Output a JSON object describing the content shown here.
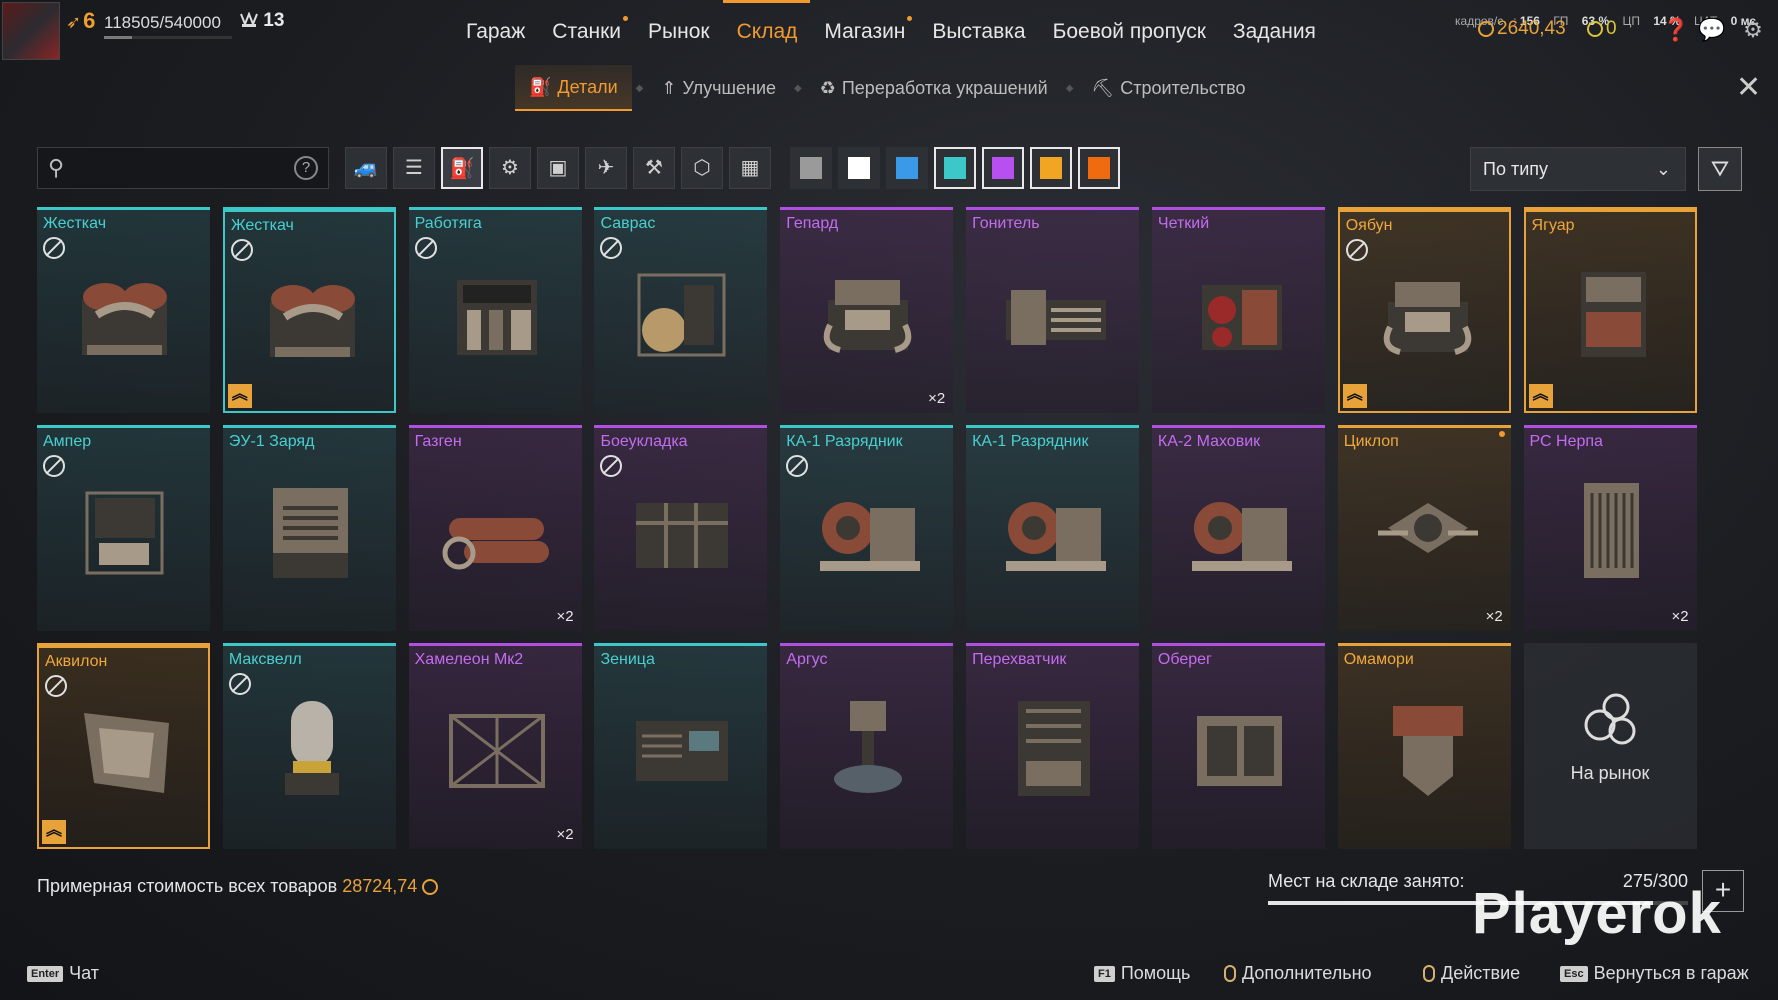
{
  "player": {
    "level": "6",
    "xp": "118505/540000",
    "xp_fraction": 0.22,
    "rank": "13"
  },
  "main_nav": [
    {
      "label": "Гараж"
    },
    {
      "label": "Станки",
      "dot": true
    },
    {
      "label": "Рынок"
    },
    {
      "label": "Склад",
      "active": true
    },
    {
      "label": "Магазин",
      "dot": true
    },
    {
      "label": "Выставка"
    },
    {
      "label": "Боевой пропуск"
    },
    {
      "label": "Задания"
    }
  ],
  "stats": {
    "fps_label": "кадров/с",
    "fps": "156",
    "gpu_label": "ГП",
    "gpu": "63 %",
    "cpu_label": "ЦП",
    "cpu": "14 %",
    "ping_label": "ЦАТ",
    "ping": "0 мс"
  },
  "currency": {
    "coins": "2640,43",
    "badges": "0"
  },
  "sub_nav": [
    {
      "label": "Детали",
      "active": true,
      "icon": "engine-icon"
    },
    {
      "label": "Улучшение",
      "icon": "upgrade-icon"
    },
    {
      "label": "Переработка украшений",
      "icon": "recycle-icon"
    },
    {
      "label": "Строительство",
      "icon": "build-icon"
    }
  ],
  "search": {
    "placeholder": ""
  },
  "category_filters": [
    {
      "icon": "cabin-icon"
    },
    {
      "icon": "weapon-icon"
    },
    {
      "icon": "engine-icon",
      "selected": true
    },
    {
      "icon": "wheel-icon"
    },
    {
      "icon": "frame-icon"
    },
    {
      "icon": "drone-icon"
    },
    {
      "icon": "tool-icon"
    },
    {
      "icon": "gear-hex-icon"
    },
    {
      "icon": "all-grid-icon"
    }
  ],
  "rarity_filters": [
    {
      "color": "#9a9a9a"
    },
    {
      "color": "#ffffff"
    },
    {
      "color": "#3b9ae8"
    },
    {
      "color": "#3cc8c8",
      "selected": true
    },
    {
      "color": "#b84ff0",
      "selected": true
    },
    {
      "color": "#f2a423",
      "selected": true
    },
    {
      "color": "#f06a10",
      "selected": true
    }
  ],
  "sort": {
    "label": "По типу"
  },
  "items": [
    {
      "name": "Жесткач",
      "rarity": "cyan",
      "nosell": true,
      "art": "engine-twin"
    },
    {
      "name": "Жесткач",
      "rarity": "cyan",
      "nosell": true,
      "art": "engine-twin",
      "selected": true,
      "upgrade": true
    },
    {
      "name": "Работяга",
      "rarity": "cyan",
      "nosell": true,
      "art": "engine-block"
    },
    {
      "name": "Саврас",
      "rarity": "cyan",
      "nosell": true,
      "art": "engine-cage"
    },
    {
      "name": "Гепард",
      "rarity": "purple",
      "art": "engine-v8",
      "count": "×2"
    },
    {
      "name": "Гонитель",
      "rarity": "purple",
      "art": "engine-long"
    },
    {
      "name": "Четкий",
      "rarity": "purple",
      "art": "engine-red"
    },
    {
      "name": "Оябун",
      "rarity": "orange",
      "nosell": true,
      "art": "engine-v8",
      "selected": true,
      "upgrade": true
    },
    {
      "name": "Ягуар",
      "rarity": "orange",
      "art": "engine-tall",
      "selected": true,
      "upgrade": true
    },
    {
      "name": "Ампер",
      "rarity": "cyan",
      "nosell": true,
      "art": "generator"
    },
    {
      "name": "ЭУ-1 Заряд",
      "rarity": "cyan",
      "art": "box-vent"
    },
    {
      "name": "Газген",
      "rarity": "purple",
      "art": "tanks",
      "count": "×2"
    },
    {
      "name": "Боеукладка",
      "rarity": "purple",
      "nosell": true,
      "art": "crate"
    },
    {
      "name": "КА-1 Разрядник",
      "rarity": "cyan",
      "nosell": true,
      "art": "coils"
    },
    {
      "name": "КА-1 Разрядник",
      "rarity": "cyan",
      "art": "coils"
    },
    {
      "name": "КА-2 Маховик",
      "rarity": "purple",
      "art": "coils"
    },
    {
      "name": "Циклоп",
      "rarity": "orange",
      "art": "drone",
      "count": "×2",
      "newdot": true
    },
    {
      "name": "РС Нерпа",
      "rarity": "purple",
      "art": "radiator",
      "count": "×2"
    },
    {
      "name": "Аквилон",
      "rarity": "orange",
      "nosell": true,
      "art": "wedge",
      "selected": true,
      "upgrade": true
    },
    {
      "name": "Максвелл",
      "rarity": "cyan",
      "nosell": true,
      "art": "capsule"
    },
    {
      "name": "Хамелеон Мк2",
      "rarity": "purple",
      "art": "cage-crate",
      "count": "×2"
    },
    {
      "name": "Зеница",
      "rarity": "cyan",
      "art": "console"
    },
    {
      "name": "Аргус",
      "rarity": "purple",
      "art": "turret"
    },
    {
      "name": "Перехватчик",
      "rarity": "purple",
      "art": "tower"
    },
    {
      "name": "Оберег",
      "rarity": "purple",
      "art": "block"
    },
    {
      "name": "Омамори",
      "rarity": "orange",
      "art": "shield"
    }
  ],
  "market_tile": {
    "label": "На рынок"
  },
  "footer": {
    "total_label": "Примерная стоимость всех товаров",
    "total_value": "28724,74",
    "storage_label": "Мест на складе занято:",
    "storage_count": "275/300",
    "storage_fraction": 0.917,
    "watermark": "Playerok"
  },
  "hints": [
    {
      "key": "Enter",
      "label": "Чат"
    },
    {
      "key": "F1",
      "label": "Помощь"
    },
    {
      "mouse": true,
      "label": "Дополнительно"
    },
    {
      "mouse": true,
      "label": "Действие"
    },
    {
      "key": "Esc",
      "label": "Вернуться в гараж"
    }
  ]
}
